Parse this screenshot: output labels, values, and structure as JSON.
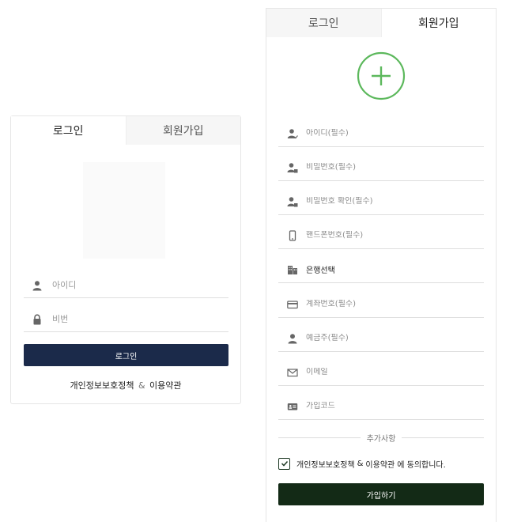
{
  "login": {
    "tabs": {
      "login": "로그인",
      "signup": "회원가입"
    },
    "id_placeholder": "아이디",
    "pw_placeholder": "비번",
    "button": "로그인",
    "privacy": "개인정보보호정책",
    "amp": "&",
    "terms": "이용약관"
  },
  "signup": {
    "tabs": {
      "login": "로그인",
      "signup": "회원가입"
    },
    "add_icon": "plus-circle-icon",
    "fields": {
      "id": "아이디(필수)",
      "password": "비밀번호(필수)",
      "password_confirm": "비밀번호 확인(필수)",
      "phone": "핸드폰번호(필수)",
      "bank": "은행선택",
      "account": "계좌번호(필수)",
      "depositor": "예금주(필수)",
      "email": "이메일",
      "code": "가입코드"
    },
    "extra_label": "추가사항",
    "agree": {
      "privacy": "개인정보보호정책",
      "amp": "&",
      "terms": "이용약관",
      "suffix": "에 동의합니다.",
      "checked": true
    },
    "button": "가입하기"
  },
  "colors": {
    "login_button": "#1b2a4a",
    "signup_button": "#132a16",
    "accent_green": "#5cb85c"
  }
}
